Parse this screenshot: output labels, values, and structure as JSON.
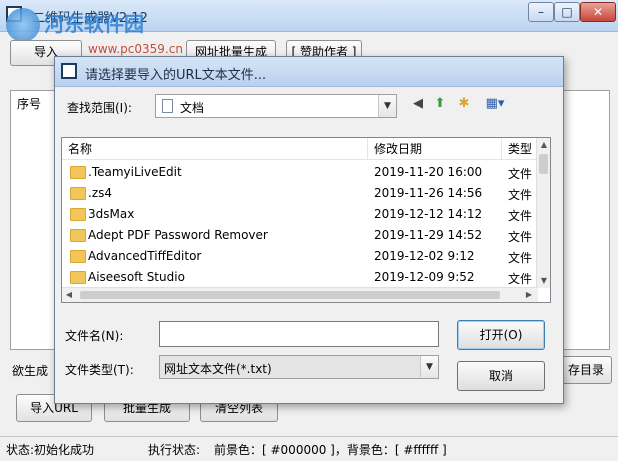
{
  "main": {
    "title": "二维码生成器V2.12",
    "buttons": [
      "导入",
      "网址批量生成",
      "[ 赞助作者 ]"
    ],
    "list_header": "序号",
    "bottom_label": "欲生成",
    "bottom_buttons": [
      "导入URL",
      "批量生成",
      "清空列表"
    ],
    "save_dir_button": "存目录",
    "window_controls": {
      "minimize": "–",
      "maximize": "□",
      "close": "✕"
    }
  },
  "watermark": {
    "line1": "河东软件园",
    "line2": "www.pc0359.cn"
  },
  "status": {
    "left": "状态:初始化成功",
    "exec_label": "执行状态:",
    "colors": "前景色：[ #000000 ]，背景色：[ #ffffff ]"
  },
  "dialog": {
    "title": "请选择要导入的URL文本文件...",
    "lookin_label": "查找范围(I):",
    "lookin_value": "文档",
    "columns": {
      "name": "名称",
      "date": "修改日期",
      "type": "类型"
    },
    "files": [
      {
        "name": ".TeamyiLiveEdit",
        "date": "2019-11-20 16:00",
        "type": "文件"
      },
      {
        "name": ".zs4",
        "date": "2019-11-26 14:56",
        "type": "文件"
      },
      {
        "name": "3dsMax",
        "date": "2019-12-12 14:12",
        "type": "文件"
      },
      {
        "name": "Adept PDF Password Remover",
        "date": "2019-11-29 14:52",
        "type": "文件"
      },
      {
        "name": "AdvancedTiffEditor",
        "date": "2019-12-02 9:12",
        "type": "文件"
      },
      {
        "name": "Aiseesoft Studio",
        "date": "2019-12-09 9:52",
        "type": "文件"
      }
    ],
    "filename_label": "文件名(N):",
    "filename_value": "",
    "filetype_label": "文件类型(T):",
    "filetype_value": "网址文本文件(*.txt)",
    "open_button": "打开(O)",
    "cancel_button": "取消"
  }
}
